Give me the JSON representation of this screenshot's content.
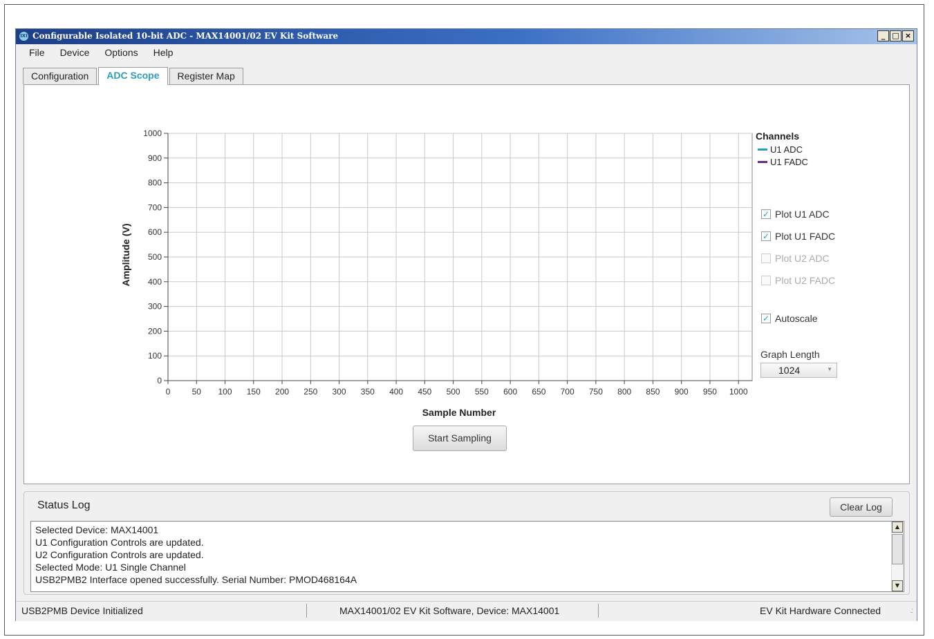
{
  "window": {
    "title": "Configurable Isolated 10-bit ADC - MAX14001/02 EV Kit Software",
    "icon_text": "IXI",
    "controls": {
      "minimize": "_",
      "maximize": "□",
      "close": "×"
    }
  },
  "menu": [
    "File",
    "Device",
    "Options",
    "Help"
  ],
  "tabs": [
    {
      "label": "Configuration",
      "active": false
    },
    {
      "label": "ADC Scope",
      "active": true
    },
    {
      "label": "Register Map",
      "active": false
    }
  ],
  "scope": {
    "legend_title": "Channels",
    "legend": [
      {
        "label": "U1 ADC",
        "color": "#2aa0b8"
      },
      {
        "label": "U1 FADC",
        "color": "#6b2a7a"
      }
    ],
    "checkboxes": [
      {
        "label": "Plot U1 ADC",
        "checked": true,
        "enabled": true
      },
      {
        "label": "Plot U1 FADC",
        "checked": true,
        "enabled": true
      },
      {
        "label": "Plot U2 ADC",
        "checked": false,
        "enabled": false
      },
      {
        "label": "Plot U2 FADC",
        "checked": false,
        "enabled": false
      }
    ],
    "autoscale": {
      "label": "Autoscale",
      "checked": true
    },
    "graph_length_label": "Graph Length",
    "graph_length_value": "1024",
    "start_button": "Start Sampling"
  },
  "chart_data": {
    "type": "line",
    "xlabel": "Sample Number",
    "ylabel": "Amplitude (V)",
    "xlim": [
      0,
      1024
    ],
    "ylim": [
      0,
      1000
    ],
    "x_ticks": [
      0,
      50,
      100,
      150,
      200,
      250,
      300,
      350,
      400,
      450,
      500,
      550,
      600,
      650,
      700,
      750,
      800,
      850,
      900,
      950,
      1000
    ],
    "y_ticks": [
      0,
      100,
      200,
      300,
      400,
      500,
      600,
      700,
      800,
      900,
      1000
    ],
    "grid": true,
    "legend_position": "right",
    "series": [
      {
        "name": "U1 ADC",
        "values": []
      },
      {
        "name": "U1 FADC",
        "values": []
      }
    ]
  },
  "status_log": {
    "title": "Status Log",
    "clear_button": "Clear Log",
    "lines": [
      "Selected Device: MAX14001",
      "U1 Configuration Controls are updated.",
      "U2 Configuration Controls are updated.",
      "Selected Mode: U1 Single Channel",
      "USB2PMB2 Interface opened successfully. Serial Number: PMOD468164A"
    ]
  },
  "statusbar": {
    "left": "USB2PMB Device Initialized",
    "center": "MAX14001/02 EV Kit Software, Device: MAX14001",
    "right": "EV Kit Hardware Connected",
    "grip": ".:"
  }
}
